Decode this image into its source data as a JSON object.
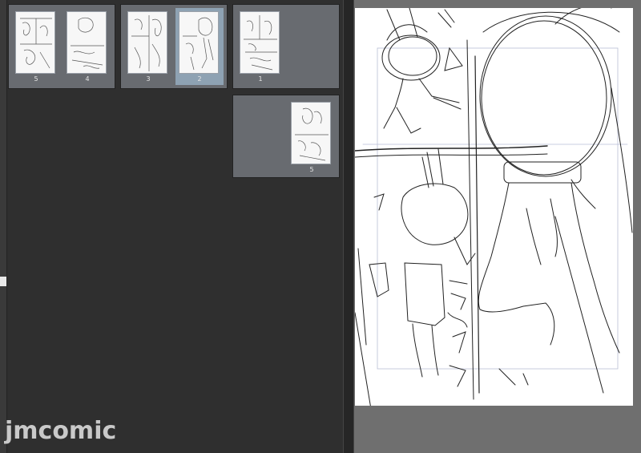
{
  "page_panel": {
    "spreads": [
      {
        "pages": [
          {
            "number": "5"
          },
          {
            "number": "4"
          }
        ]
      },
      {
        "pages": [
          {
            "number": "3"
          },
          {
            "number": "2",
            "selected": true
          }
        ]
      },
      {
        "pages": [
          {
            "number": "1"
          }
        ]
      },
      {
        "pages": [
          {
            "number": "5"
          }
        ]
      }
    ]
  },
  "watermark": {
    "text": "jmcomic"
  },
  "colors": {
    "panel_bg": "#2f2f2f",
    "spread_bg": "#686b70",
    "selected_page": "#8ea2b3",
    "canvas_bg": "#ffffff"
  }
}
